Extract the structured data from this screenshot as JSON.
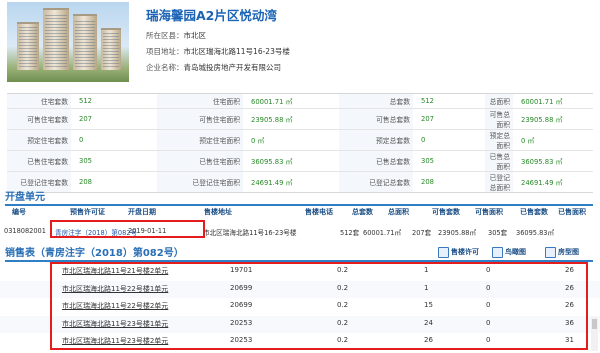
{
  "project": {
    "title": "瑞海馨园A2片区悦动湾",
    "district_label": "所在区县：",
    "district_value": "市北区",
    "address_label": "项目地址：",
    "address_value": "市北区瑞海北路11号16-23号楼",
    "company_label": "企业名称：",
    "company_value": "青岛城投房地产开发有限公司"
  },
  "stats": [
    [
      "住宅套数",
      "512",
      "住宅面积",
      "60001.71 ㎡",
      "总套数",
      "512",
      "总面积",
      "60001.71 ㎡"
    ],
    [
      "可售住宅套数",
      "207",
      "可售住宅面积",
      "23905.88 ㎡",
      "可售总套数",
      "207",
      "可售总面积",
      "23905.88 ㎡"
    ],
    [
      "预定住宅套数",
      "0",
      "预定住宅面积",
      "0 ㎡",
      "预定总套数",
      "0",
      "预定总面积",
      "0 ㎡"
    ],
    [
      "已售住宅套数",
      "305",
      "已售住宅面积",
      "36095.83 ㎡",
      "已售总套数",
      "305",
      "已售总面积",
      "36095.83 ㎡"
    ],
    [
      "已登记住宅套数",
      "208",
      "已登记住宅面积",
      "24691.49 ㎡",
      "已登记总套数",
      "208",
      "已登记总面积",
      "24691.49 ㎡"
    ]
  ],
  "kaipan": {
    "section_title": "开盘单元",
    "headers": [
      "编号",
      "预售许可证",
      "开盘日期",
      "售楼地址",
      "售楼电话",
      "总套数",
      "总面积",
      "可售套数",
      "可售面积",
      "已售套数",
      "已售面积"
    ],
    "row": [
      "0318082001",
      "青房注字（2018）第082号",
      "2019-01-11",
      "市北区瑞海北路11号16-23号楼",
      "",
      "512套",
      "60001.71㎡",
      "207套",
      "23905.88㎡",
      "305套",
      "36095.83㎡"
    ]
  },
  "sales": {
    "section_title": "销售表（青房注字（2018）第082号）",
    "btn_permit": "售楼许可",
    "btn_bird": "鸟瞰图",
    "btn_house": "房型图",
    "rows": [
      {
        "name": "市北区瑞海北路11号21号楼2单元",
        "c1": "19701",
        "c2": "0.2",
        "c3": "1",
        "c4": "0",
        "c5": "26"
      },
      {
        "name": "市北区瑞海北路11号22号楼1单元",
        "c1": "20699",
        "c2": "0.2",
        "c3": "1",
        "c4": "0",
        "c5": "26"
      },
      {
        "name": "市北区瑞海北路11号22号楼2单元",
        "c1": "20699",
        "c2": "0.2",
        "c3": "15",
        "c4": "0",
        "c5": "26"
      },
      {
        "name": "市北区瑞海北路11号23号楼1单元",
        "c1": "20253",
        "c2": "0.2",
        "c3": "24",
        "c4": "0",
        "c5": "36"
      },
      {
        "name": "市北区瑞海北路11号23号楼2单元",
        "c1": "20253",
        "c2": "0.2",
        "c3": "26",
        "c4": "0",
        "c5": "31"
      }
    ]
  }
}
